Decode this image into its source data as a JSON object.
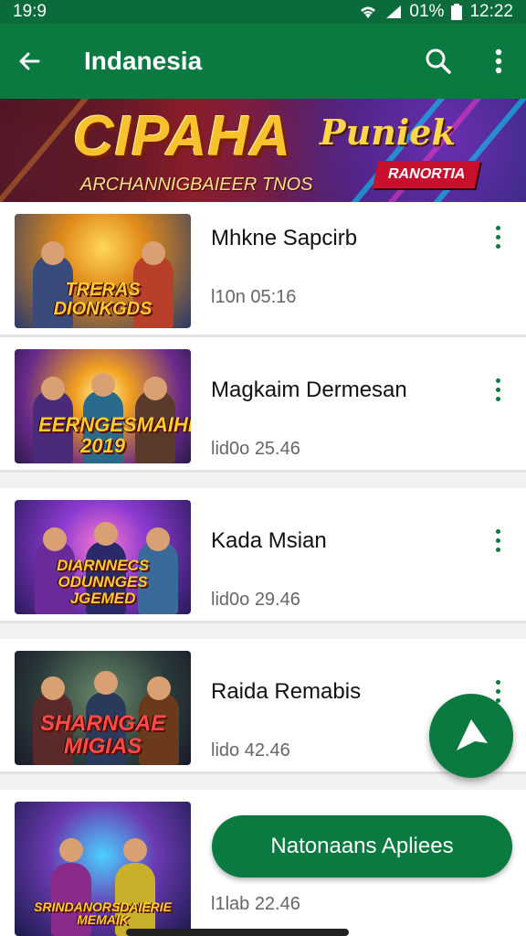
{
  "status": {
    "time_left": "19:9",
    "battery": "01%",
    "time_right": "12:22"
  },
  "appbar": {
    "title": "Indanesia",
    "back_icon": "arrow-left-icon",
    "search_icon": "search-icon",
    "menu_icon": "more-vert-icon"
  },
  "banner": {
    "title": "CIPAHA",
    "script": "Puniek",
    "subtitle": "ARCHANNIGBAIEER TNOS",
    "badge": "RANORTIA"
  },
  "items": [
    {
      "title": "Mhkne Sapcirb",
      "meta": "l10n 05:16",
      "thumb_text": "TRERAS DIONKGDS"
    },
    {
      "title": "Magkaim Dermesan",
      "meta": "lid0o 25.46",
      "thumb_text": "EERNGESMAIHI 2019"
    },
    {
      "title": "Kada Msian",
      "meta": "lid0o 29.46",
      "thumb_text": "DIARNNECS ODUNNGES JGEMED"
    },
    {
      "title": "Raida Remabis",
      "meta": "lido 42.46",
      "thumb_text": "SHARNGAE MIGIAS"
    },
    {
      "title": "",
      "meta": "l1lab 22.46",
      "thumb_text": "SRINDANORSDAIERIE MEMAIK"
    }
  ],
  "fab": {
    "icon": "navigation-arrow-icon"
  },
  "pill_button": {
    "label": "Natonaans Apliees"
  },
  "colors": {
    "primary": "#0a7a40",
    "status_bar": "#0b6b3a",
    "accent_gold": "#f7c22c"
  }
}
